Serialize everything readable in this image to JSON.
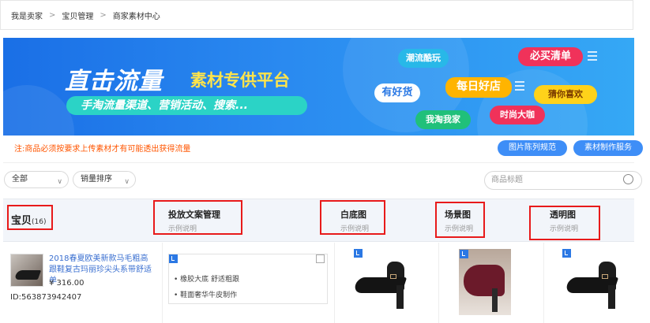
{
  "breadcrumb": [
    "我是卖家",
    "宝贝管理",
    "商家素材中心"
  ],
  "breadcrumb_sep": ">",
  "banner": {
    "title": "直击流量",
    "title2": "素材专供平台",
    "subtitle": "手淘流量渠道、营销活动、搜索...",
    "tags": [
      "潮流酷玩",
      "必买清单",
      "有好货",
      "每日好店",
      "猜你喜欢",
      "时尚大咖",
      "我淘我家"
    ]
  },
  "notice": "注:商品必须按要求上传素材才有可能透出获得流量",
  "buttons": {
    "pic_spec": "图片陈列规范",
    "material_service": "素材制作服务"
  },
  "filters": {
    "all": "全部",
    "sort": "销量排序",
    "search_placeholder": "商品标题"
  },
  "table": {
    "col_item": "宝贝",
    "col_item_count": "(16)",
    "col_copy": "投放文案管理",
    "col_white": "白底图",
    "col_scene": "场景图",
    "col_transparent": "透明图",
    "example": "示例说明"
  },
  "product": {
    "title": "2018春夏欧美新款马毛粗高跟鞋复古玛丽珍尖头系带舒适单",
    "price": "¥ 316.00",
    "id": "ID:563873942407",
    "copy_lines": [
      "橡胶大底 舒适粗跟",
      "鞋面奢华牛皮制作"
    ]
  },
  "colors": {
    "accent": "#3e8ef7",
    "notice": "#ff5500",
    "highlight": "#e81a1a",
    "link": "#3a6fd0"
  }
}
